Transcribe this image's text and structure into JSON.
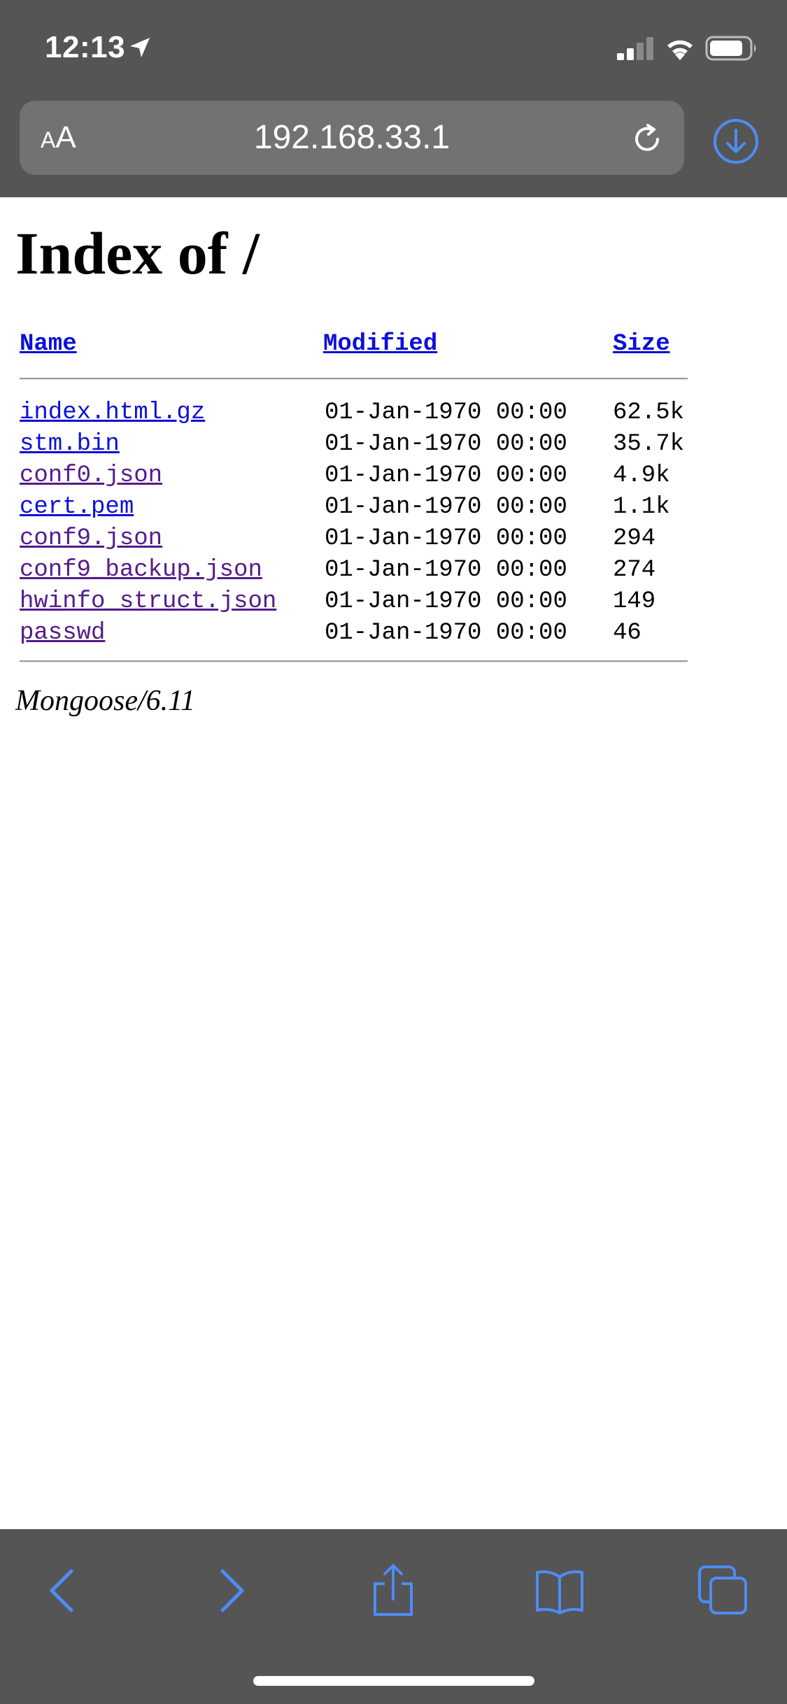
{
  "status_bar": {
    "time": "12:13",
    "icons": [
      "location-arrow-icon",
      "cellular-signal-icon",
      "wifi-icon",
      "battery-icon"
    ]
  },
  "address_bar": {
    "reader_label_small": "A",
    "reader_label_large": "A",
    "url": "192.168.33.1",
    "icons": [
      "reload-icon",
      "download-icon"
    ]
  },
  "page": {
    "title": "Index of /",
    "columns": {
      "name": "Name",
      "modified": "Modified",
      "size": "Size"
    },
    "files": [
      {
        "name": "index.html.gz",
        "modified": "01-Jan-1970 00:00",
        "size": "62.5k",
        "visited": false
      },
      {
        "name": "stm.bin",
        "modified": "01-Jan-1970 00:00",
        "size": "35.7k",
        "visited": false
      },
      {
        "name": "conf0.json",
        "modified": "01-Jan-1970 00:00",
        "size": "4.9k",
        "visited": true
      },
      {
        "name": "cert.pem",
        "modified": "01-Jan-1970 00:00",
        "size": "1.1k",
        "visited": false
      },
      {
        "name": "conf9.json",
        "modified": "01-Jan-1970 00:00",
        "size": "294",
        "visited": true
      },
      {
        "name": "conf9_backup.json",
        "modified": "01-Jan-1970 00:00",
        "size": "274",
        "visited": true
      },
      {
        "name": "hwinfo_struct.json",
        "modified": "01-Jan-1970 00:00",
        "size": "149",
        "visited": true
      },
      {
        "name": "passwd",
        "modified": "01-Jan-1970 00:00",
        "size": "46",
        "visited": true
      }
    ],
    "footer": "Mongoose/6.11"
  },
  "toolbar": {
    "icons": [
      "back-icon",
      "forward-icon",
      "share-icon",
      "bookmarks-icon",
      "tabs-icon"
    ]
  },
  "colors": {
    "chrome_background": "#555556",
    "address_field": "#727272",
    "accent_blue": "#4c8df6",
    "link": "#0b10d9",
    "visited_link": "#551a8b"
  }
}
